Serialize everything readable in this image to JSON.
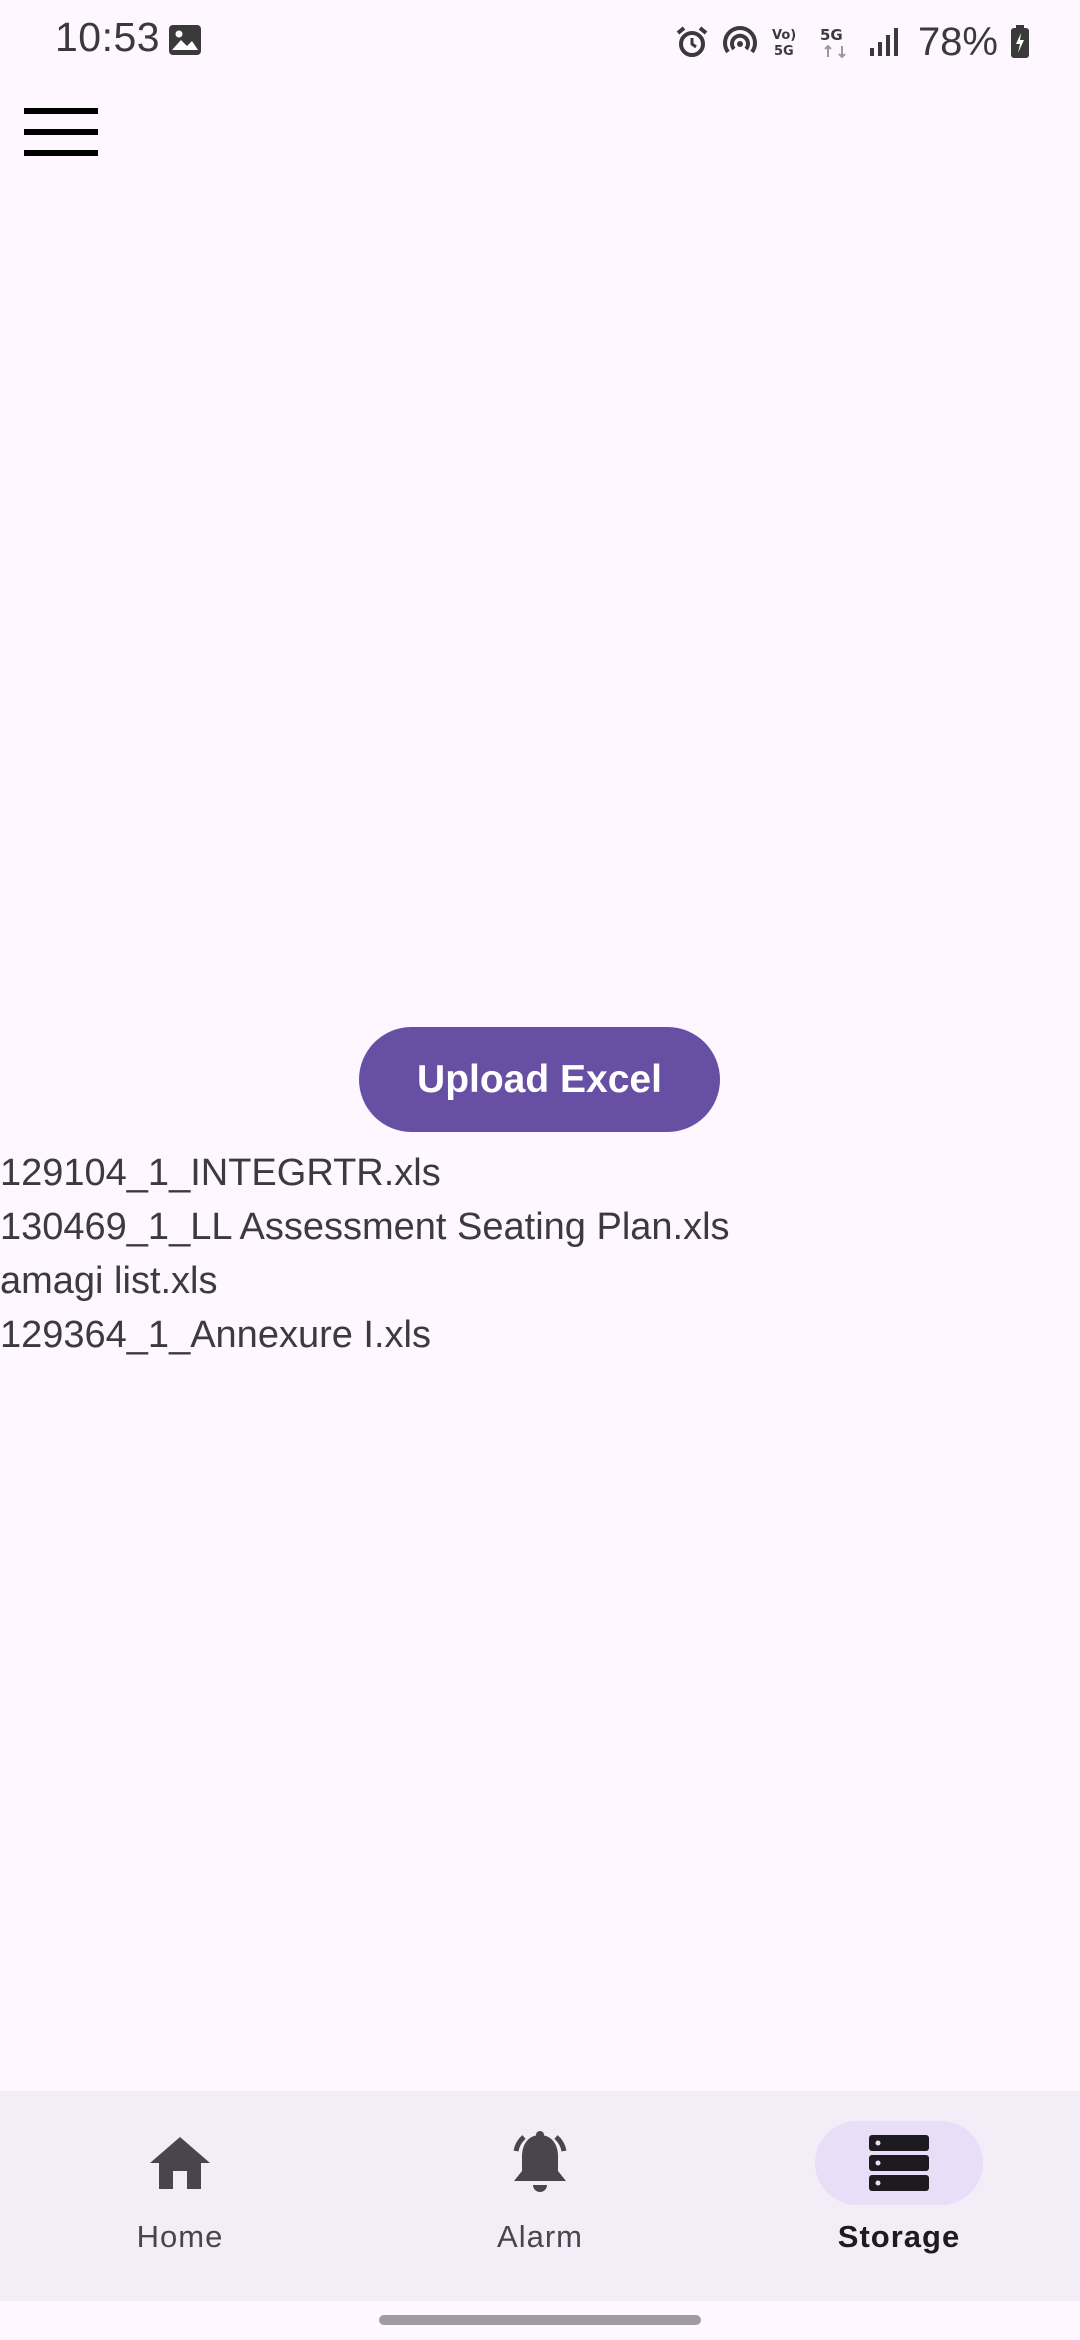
{
  "status_bar": {
    "time": "10:53",
    "battery": "78%",
    "icons": [
      "image-icon",
      "alarm-clock-icon",
      "hotspot-icon",
      "volte-icon",
      "5g-icon",
      "signal-icon",
      "battery-icon"
    ]
  },
  "top_bar": {
    "menu_icon": "hamburger-menu-icon"
  },
  "main": {
    "upload_label": "Upload Excel",
    "files": [
      "129104_1_INTEGRTR.xls",
      "130469_1_LL Assessment Seating Plan.xls",
      "amagi list.xls",
      "129364_1_Annexure I.xls"
    ]
  },
  "bottom_nav": {
    "items": [
      {
        "label": "Home",
        "icon": "home-icon",
        "active": false
      },
      {
        "label": "Alarm",
        "icon": "bell-icon",
        "active": false
      },
      {
        "label": "Storage",
        "icon": "storage-icon",
        "active": true
      }
    ]
  },
  "colors": {
    "background": "#FEF7FF",
    "primary": "#6750A4",
    "nav_background": "#F3EDF7",
    "active_indicator": "#E8DEF8"
  }
}
